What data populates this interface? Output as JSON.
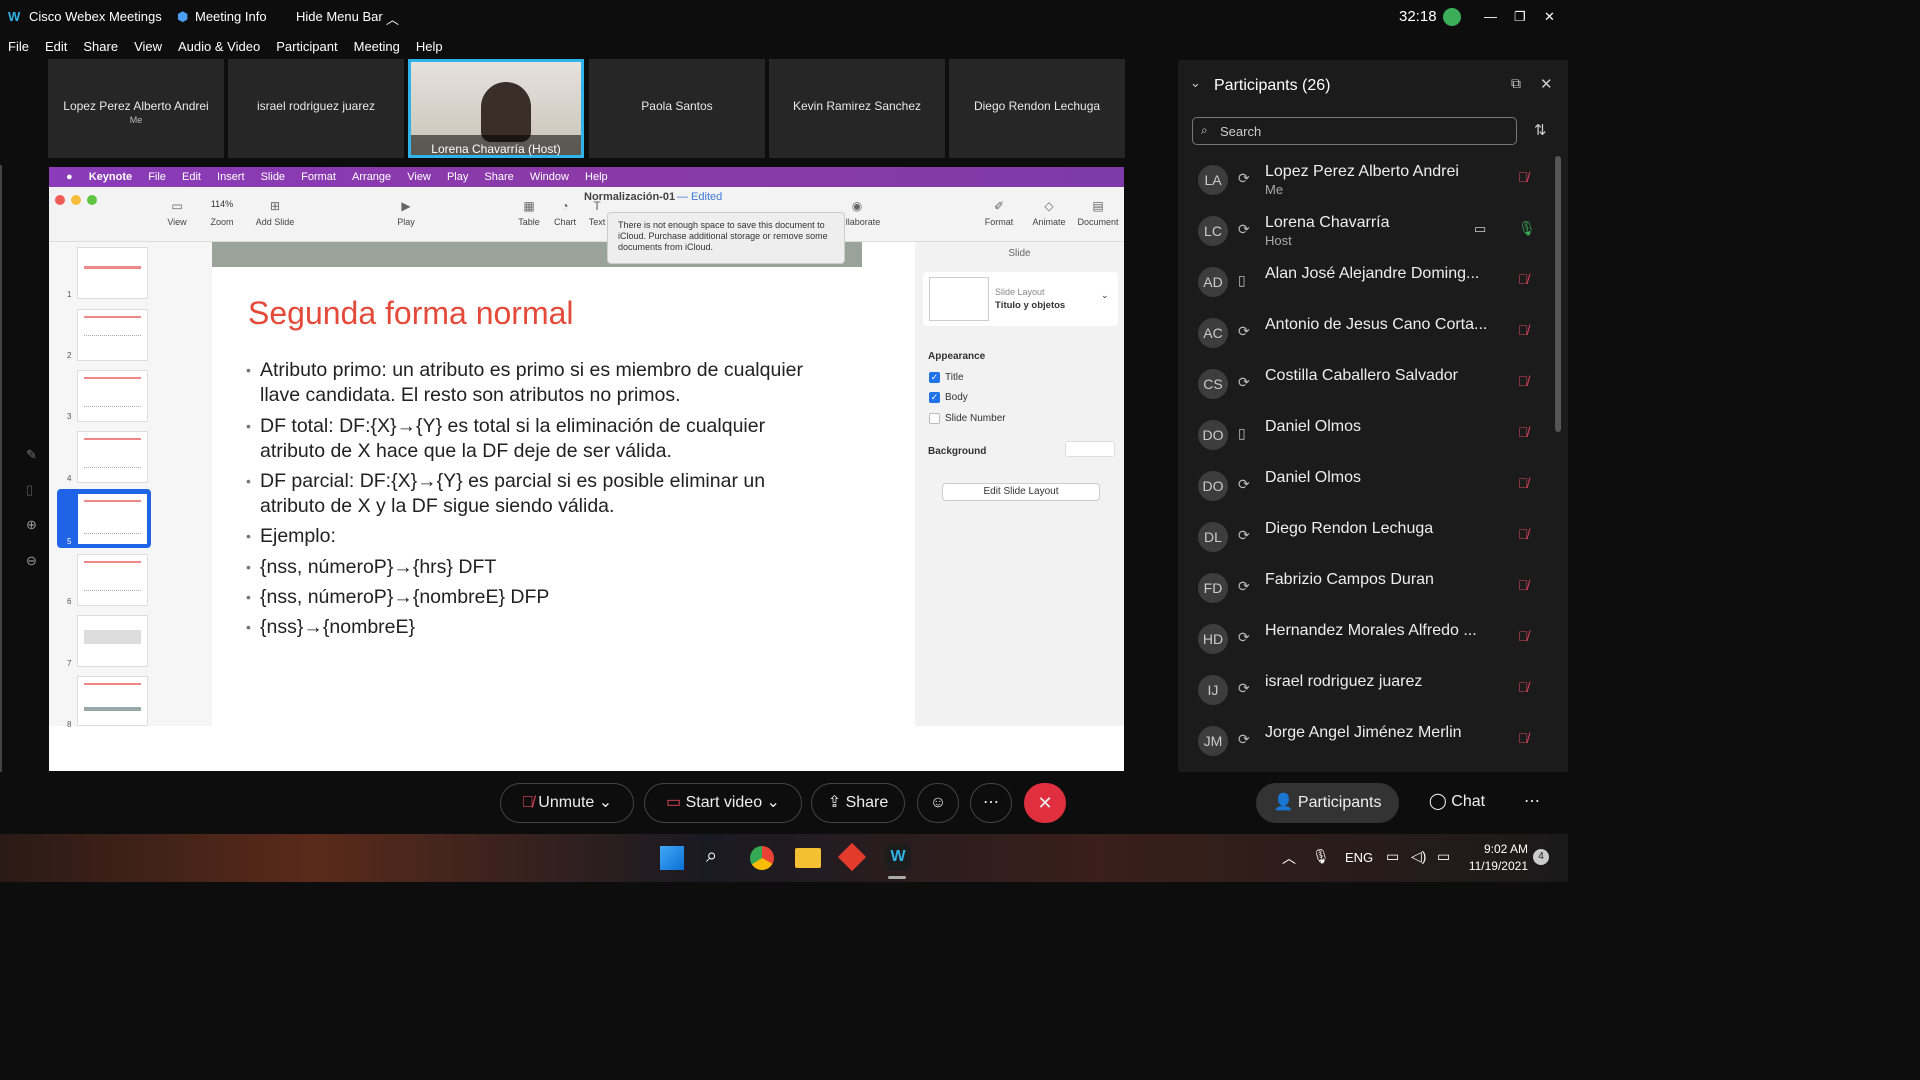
{
  "app": {
    "title": "Cisco Webex Meetings",
    "meeting_info": "Meeting Info",
    "hide_menu": "Hide Menu Bar",
    "timer": "32:18"
  },
  "menu": [
    "File",
    "Edit",
    "Share",
    "View",
    "Audio & Video",
    "Participant",
    "Meeting",
    "Help"
  ],
  "videos": [
    {
      "name": "Lopez Perez Alberto Andrei",
      "sub": "Me"
    },
    {
      "name": "israel rodriguez juarez",
      "sub": ""
    },
    {
      "name": "Lorena Chavarría  (Host)",
      "sub": ""
    },
    {
      "name": "Paola Santos",
      "sub": ""
    },
    {
      "name": "Kevin Ramirez Sanchez",
      "sub": ""
    },
    {
      "name": "Diego Rendon Lechuga",
      "sub": ""
    }
  ],
  "keynote": {
    "menu": [
      "Keynote",
      "File",
      "Edit",
      "Insert",
      "Slide",
      "Format",
      "Arrange",
      "View",
      "Play",
      "Share",
      "Window",
      "Help"
    ],
    "doc_title": "Normalización-01",
    "edited": "— Edited",
    "tools": [
      "View",
      "Zoom",
      "Add Slide",
      "Play",
      "Table",
      "Chart",
      "Text",
      "llaborate",
      "Format",
      "Animate",
      "Document"
    ],
    "zoom": "114%",
    "tooltip": "There is not enough space to save this document to iCloud. Purchase additional storage or remove some documents from iCloud.",
    "thumb_numbers": [
      "1",
      "2",
      "3",
      "4",
      "5",
      "6",
      "7",
      "8"
    ],
    "slide_title": "Segunda forma normal",
    "bullets": [
      "Atributo primo: un atributo es primo si es miembro de cualquier llave candidata. El resto son atributos no primos.",
      "DF total: DF:{X}→{Y} es total si la eliminación de cualquier atributo de X hace que la DF deje de ser válida.",
      "DF parcial: DF:{X}→{Y} es parcial si es posible eliminar un atributo de X y la DF sigue siendo válida.",
      "Ejemplo:",
      "{nss, númeroP}→{hrs} DFT",
      "{nss, númeroP}→{nombreE} DFP",
      "{nss}→{nombreE}"
    ],
    "inspector": {
      "tab": "Slide",
      "layout_label": "Slide Layout",
      "layout_value": "Título y objetos",
      "appearance": "Appearance",
      "opt_title": "Title",
      "opt_body": "Body",
      "opt_slide_number": "Slide Number",
      "background": "Background",
      "edit_layout": "Edit Slide Layout"
    }
  },
  "participants": {
    "title": "Participants (26)",
    "search_placeholder": "Search",
    "list": [
      {
        "initials": "LA",
        "name": "Lopez Perez Alberto Andrei",
        "sub": "Me"
      },
      {
        "initials": "LC",
        "name": "Lorena Chavarría",
        "sub": "Host"
      },
      {
        "initials": "AD",
        "name": "Alan José Alejandre Doming...",
        "sub": ""
      },
      {
        "initials": "AC",
        "name": "Antonio de Jesus Cano Corta...",
        "sub": ""
      },
      {
        "initials": "CS",
        "name": "Costilla Caballero Salvador",
        "sub": ""
      },
      {
        "initials": "DO",
        "name": "Daniel Olmos",
        "sub": ""
      },
      {
        "initials": "DO",
        "name": "Daniel Olmos",
        "sub": ""
      },
      {
        "initials": "DL",
        "name": "Diego Rendon Lechuga",
        "sub": ""
      },
      {
        "initials": "FD",
        "name": "Fabrizio Campos Duran",
        "sub": ""
      },
      {
        "initials": "HD",
        "name": "Hernandez Morales Alfredo ...",
        "sub": ""
      },
      {
        "initials": "IJ",
        "name": "israel rodriguez juarez",
        "sub": ""
      },
      {
        "initials": "JM",
        "name": "Jorge Angel Jiménez Merlin",
        "sub": ""
      }
    ]
  },
  "controls": {
    "unmute": "Unmute",
    "start_video": "Start video",
    "share": "Share",
    "participants": "Participants",
    "chat": "Chat"
  },
  "taskbar": {
    "lang": "ENG",
    "time": "9:02 AM",
    "date": "11/19/2021",
    "badge": "4"
  },
  "colors": {
    "accent": "#2fb3e8",
    "end_call": "#e0303f",
    "slide_title": "#e44a3a",
    "keynote_bar": "#8a3bb9"
  }
}
